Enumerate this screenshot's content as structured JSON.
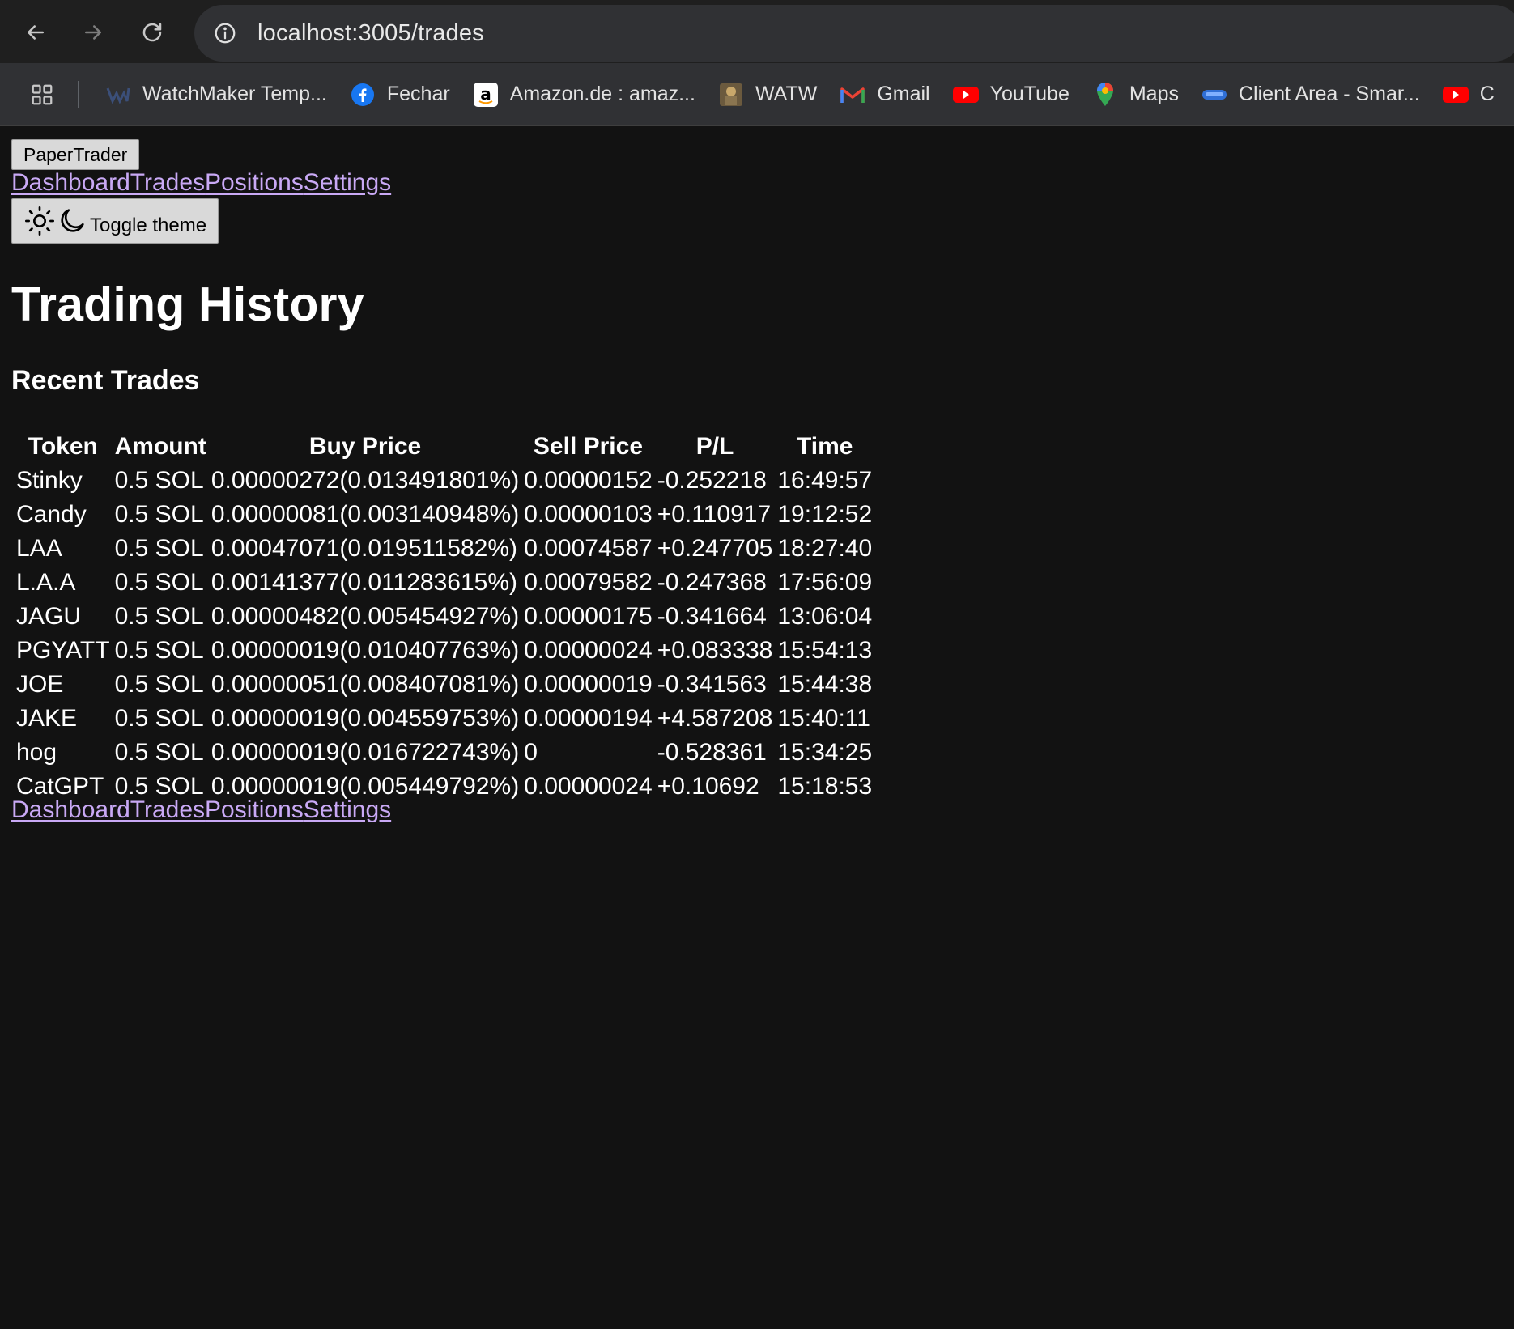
{
  "browser": {
    "url": "localhost:3005/trades",
    "bookmarks": [
      {
        "label": "WatchMaker Temp...",
        "icon": "watchmaker-icon"
      },
      {
        "label": "Fechar",
        "icon": "facebook-icon"
      },
      {
        "label": "Amazon.de : amaz...",
        "icon": "amazon-icon"
      },
      {
        "label": "WATW",
        "icon": "watw-icon"
      },
      {
        "label": "Gmail",
        "icon": "gmail-icon"
      },
      {
        "label": "YouTube",
        "icon": "youtube-icon"
      },
      {
        "label": "Maps",
        "icon": "maps-icon"
      },
      {
        "label": "Client Area - Smar...",
        "icon": "client-area-icon"
      },
      {
        "label": "C",
        "icon": "youtube-icon"
      }
    ]
  },
  "app": {
    "brand": "PaperTrader",
    "nav": [
      "Dashboard",
      "Trades",
      "Positions",
      "Settings"
    ],
    "theme_toggle": "Toggle theme",
    "link_color": "#c9a9f5"
  },
  "page": {
    "title": "Trading History",
    "section_title": "Recent Trades"
  },
  "table": {
    "headers": [
      "Token",
      "Amount",
      "Buy Price",
      "Sell Price",
      "P/L",
      "Time"
    ],
    "rows": [
      [
        "Stinky",
        "0.5 SOL",
        "0.00000272(0.013491801%)",
        "0.00000152",
        "-0.252218",
        "16:49:57"
      ],
      [
        "Candy",
        "0.5 SOL",
        "0.00000081(0.003140948%)",
        "0.00000103",
        "+0.110917",
        "19:12:52"
      ],
      [
        "LAA",
        "0.5 SOL",
        "0.00047071(0.019511582%)",
        "0.00074587",
        "+0.247705",
        "18:27:40"
      ],
      [
        "L.A.A",
        "0.5 SOL",
        "0.00141377(0.011283615%)",
        "0.00079582",
        "-0.247368",
        "17:56:09"
      ],
      [
        "JAGU",
        "0.5 SOL",
        "0.00000482(0.005454927%)",
        "0.00000175",
        "-0.341664",
        "13:06:04"
      ],
      [
        "PGYATT",
        "0.5 SOL",
        "0.00000019(0.010407763%)",
        "0.00000024",
        "+0.083338",
        "15:54:13"
      ],
      [
        "JOE",
        "0.5 SOL",
        "0.00000051(0.008407081%)",
        "0.00000019",
        "-0.341563",
        "15:44:38"
      ],
      [
        "JAKE",
        "0.5 SOL",
        "0.00000019(0.004559753%)",
        "0.00000194",
        "+4.587208",
        "15:40:11"
      ],
      [
        "hog",
        "0.5 SOL",
        "0.00000019(0.016722743%)",
        "0",
        "-0.528361",
        "15:34:25"
      ],
      [
        "CatGPT",
        "0.5 SOL",
        "0.00000019(0.005449792%)",
        "0.00000024",
        "+0.10692",
        "15:18:53"
      ]
    ]
  }
}
